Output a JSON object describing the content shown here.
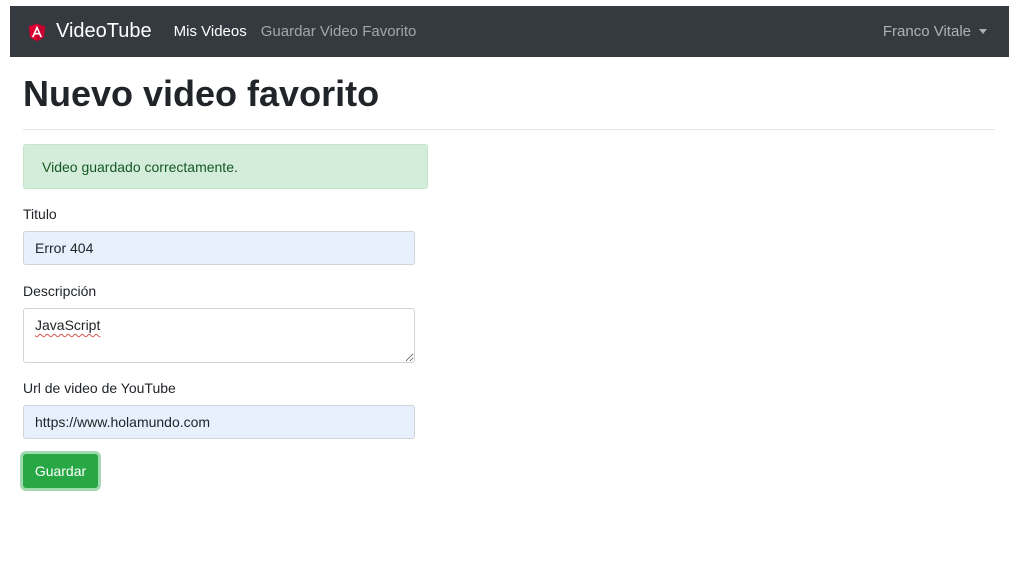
{
  "navbar": {
    "brand": "VideoTube",
    "brand_icon": "angular-logo-icon",
    "links": [
      {
        "label": "Mis Videos",
        "active": true
      },
      {
        "label": "Guardar Video Favorito",
        "active": false
      }
    ],
    "user_name": "Franco Vitale"
  },
  "page": {
    "title": "Nuevo video favorito"
  },
  "alert": {
    "message": "Video guardado correctamente."
  },
  "form": {
    "titulo_label": "Titulo",
    "titulo_value": "Error 404",
    "descripcion_label": "Descripción",
    "descripcion_value": "JavaScript",
    "url_label": "Url de video de YouTube",
    "url_value": "https://www.holamundo.com",
    "submit_label": "Guardar"
  },
  "colors": {
    "navbar_bg": "#343a40",
    "success": "#28a745",
    "alert_bg": "#d4edda",
    "alert_text": "#155724",
    "autofill_bg": "#e8f0fe",
    "angular_red": "#dd0031"
  }
}
